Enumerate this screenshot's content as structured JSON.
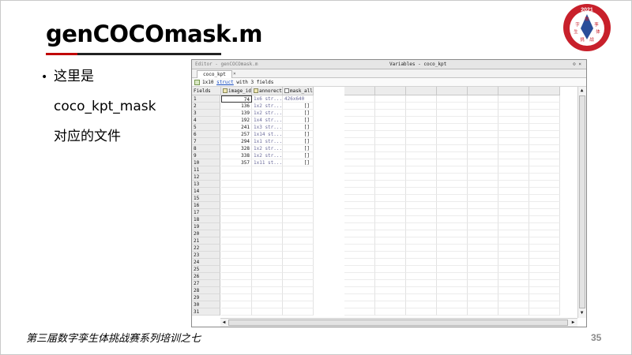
{
  "slide": {
    "title": "genCOCOmask.m",
    "bullet": [
      "这里是",
      "coco_kpt_mask",
      "对应的文件"
    ],
    "footer": "第三届数字孪生体挑战赛系列培训之七",
    "page_number": "35"
  },
  "logo": {
    "year": "2021",
    "chars": [
      "数",
      "字",
      "孪",
      "生",
      "体",
      "挑",
      "战"
    ],
    "colors": {
      "ring": "#c8202b",
      "inner": "#ffffff",
      "center": "#2a4e9a"
    }
  },
  "matlab": {
    "editor_title": "Editor - genCOCOmask.m",
    "variables_title": "Variables - coco_kpt",
    "title_icons": "⊙ ×",
    "tab_label": "coco_kpt",
    "tab_close": "×",
    "info_prefix": "1x10",
    "info_link": "struct",
    "info_suffix": "with 3 fields",
    "column_headers": [
      "Fields",
      "image_id",
      "annorect",
      "mask_all"
    ],
    "rows": [
      {
        "n": "1",
        "image_id": "74",
        "annorect": "1x6 str...",
        "mask_all": "426x640"
      },
      {
        "n": "2",
        "image_id": "136",
        "annorect": "1x2 str...",
        "mask_all": "[]"
      },
      {
        "n": "3",
        "image_id": "139",
        "annorect": "1x2 str...",
        "mask_all": "[]"
      },
      {
        "n": "4",
        "image_id": "192",
        "annorect": "1x4 str...",
        "mask_all": "[]"
      },
      {
        "n": "5",
        "image_id": "241",
        "annorect": "1x3 str...",
        "mask_all": "[]"
      },
      {
        "n": "6",
        "image_id": "257",
        "annorect": "1x14 st...",
        "mask_all": "[]"
      },
      {
        "n": "7",
        "image_id": "294",
        "annorect": "1x1 str...",
        "mask_all": "[]"
      },
      {
        "n": "8",
        "image_id": "328",
        "annorect": "1x2 str...",
        "mask_all": "[]"
      },
      {
        "n": "9",
        "image_id": "338",
        "annorect": "1x2 str...",
        "mask_all": "[]"
      },
      {
        "n": "10",
        "image_id": "357",
        "annorect": "1x11 st...",
        "mask_all": "[]"
      },
      {
        "n": "11"
      },
      {
        "n": "12"
      },
      {
        "n": "13"
      },
      {
        "n": "14"
      },
      {
        "n": "15"
      },
      {
        "n": "16"
      },
      {
        "n": "17"
      },
      {
        "n": "18"
      },
      {
        "n": "19"
      },
      {
        "n": "20"
      },
      {
        "n": "21"
      },
      {
        "n": "22"
      },
      {
        "n": "23"
      },
      {
        "n": "24"
      },
      {
        "n": "25"
      },
      {
        "n": "26"
      },
      {
        "n": "27"
      },
      {
        "n": "28"
      },
      {
        "n": "29"
      },
      {
        "n": "30"
      },
      {
        "n": "31"
      }
    ],
    "scroll_arrows": {
      "up": "▲",
      "down": "▼",
      "left": "◀",
      "right": "▶"
    }
  }
}
